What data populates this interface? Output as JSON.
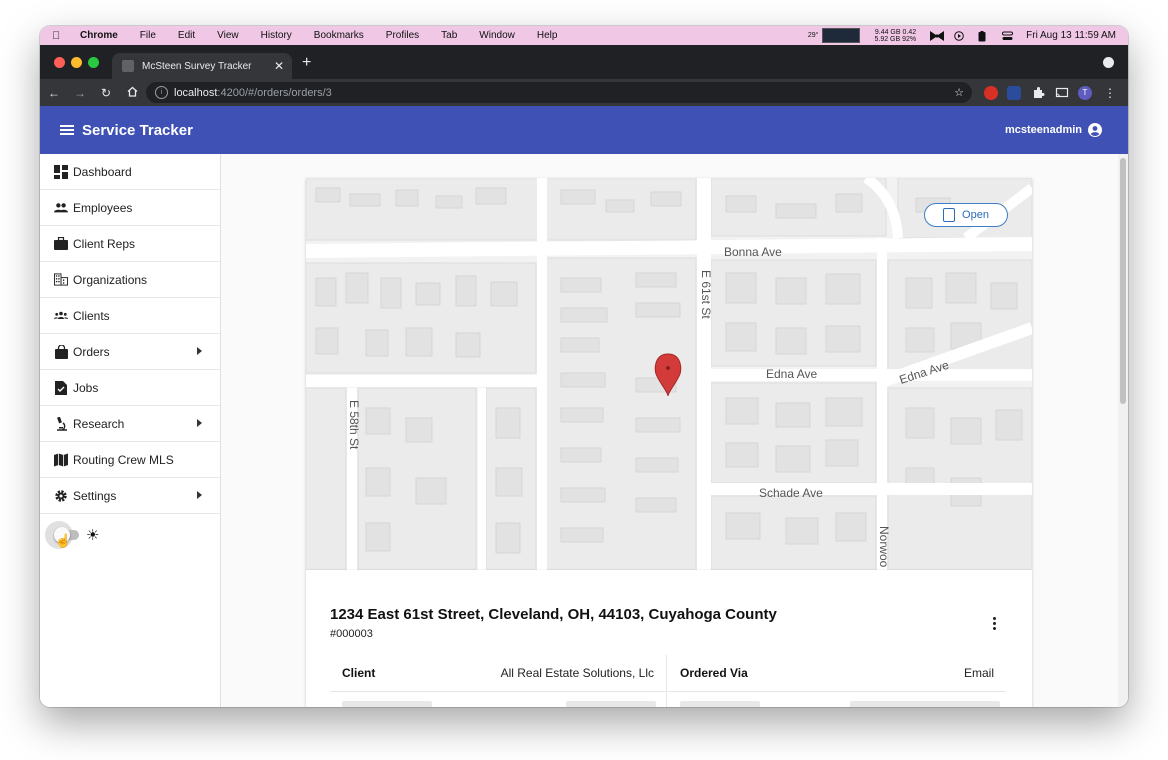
{
  "menubar": {
    "app": "Chrome",
    "items": [
      "File",
      "Edit",
      "View",
      "History",
      "Bookmarks",
      "Profiles",
      "Tab",
      "Window",
      "Help"
    ],
    "temperature": "29°",
    "stats_line1": "9.44 GB 0.42",
    "stats_line2": "5.92 GB 92%",
    "datetime": "Fri Aug 13  11:59 AM"
  },
  "browser": {
    "tab_title": "McSteen Survey Tracker",
    "tab_close": "✕",
    "new_tab": "+",
    "url_host": "localhost",
    "url_path": ":4200/#/orders/orders/3",
    "profile_initial": "T",
    "colors": {
      "traffic_red": "#ff5f57",
      "traffic_yellow": "#febc2e",
      "traffic_green": "#28c840"
    }
  },
  "toolbar": {
    "title": "Service Tracker",
    "username": "mcsteenadmin",
    "color": "#3f51b5"
  },
  "sidebar": {
    "items": [
      {
        "label": "Dashboard",
        "icon": "dashboard-icon",
        "expandable": false
      },
      {
        "label": "Employees",
        "icon": "people-icon",
        "expandable": false
      },
      {
        "label": "Client Reps",
        "icon": "briefcase-icon",
        "expandable": false
      },
      {
        "label": "Organizations",
        "icon": "building-icon",
        "expandable": false
      },
      {
        "label": "Clients",
        "icon": "groups-icon",
        "expandable": false
      },
      {
        "label": "Orders",
        "icon": "shopping-bag-icon",
        "expandable": true
      },
      {
        "label": "Jobs",
        "icon": "task-icon",
        "expandable": false
      },
      {
        "label": "Research",
        "icon": "microscope-icon",
        "expandable": true
      },
      {
        "label": "Routing Crew MLS",
        "icon": "map-icon",
        "expandable": false
      },
      {
        "label": "Settings",
        "icon": "gear-icon",
        "expandable": true
      }
    ],
    "theme_toggle_on": false
  },
  "map": {
    "open_label": "Open",
    "streets": [
      "Bonna Ave",
      "Edna Ave",
      "Edna Ave",
      "Schade Ave",
      "E 61st St",
      "E 58th St",
      "Norwoo"
    ]
  },
  "order": {
    "address": "1234 East 61st Street, Cleveland, OH, 44103, Cuyahoga County",
    "number": "#000003",
    "fields": [
      {
        "key": "Client",
        "value": "All Real Estate Solutions, Llc"
      },
      {
        "key": "Ordered Via",
        "value": "Email"
      }
    ]
  }
}
